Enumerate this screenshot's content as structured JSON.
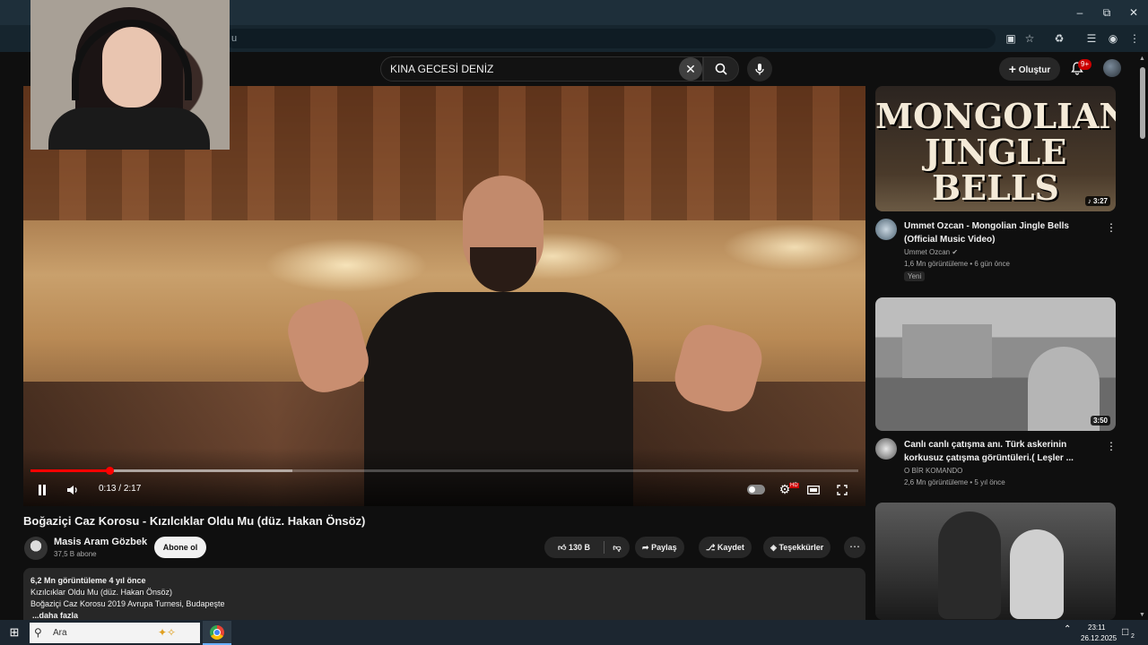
{
  "browser": {
    "address_fragment": "u",
    "window_controls": [
      "minimize-icon",
      "restore-icon",
      "close-icon"
    ],
    "toolbar_icons": [
      "cast-icon",
      "bookmark-star-icon",
      "extensions-icon",
      "media-control-icon",
      "profile-icon",
      "menu-kebab-icon"
    ]
  },
  "masthead": {
    "search_query": "KINA GECESİ DENİZ",
    "create_label": "Oluştur",
    "notifications_badge": "9+"
  },
  "player": {
    "current_time": "0:13",
    "separator": "/",
    "duration": "2:17",
    "progress_fraction": 0.095,
    "buffered_fraction": 0.316
  },
  "video": {
    "title": "Boğaziçi Caz Korosu - Kızılcıklar Oldu Mu (düz. Hakan Önsöz)",
    "channel": "Masis Aram Gözbek",
    "subscribers": "37,5 B abone",
    "subscribe_label": "Abone ol",
    "likes": "130 B",
    "share_label": "Paylaş",
    "save_label": "Kaydet",
    "thanks_label": "Teşekkürler",
    "description": {
      "stats": "6,2 Mn görüntüleme  4 yıl önce",
      "line1": "Kızılcıklar Oldu Mu (düz. Hakan Önsöz)",
      "line2": "Boğaziçi Caz Korosu 2019 Avrupa Turnesi, Budapeşte",
      "more": "...daha fazla"
    }
  },
  "sidebar": {
    "items": [
      {
        "thumb_text": "MONGOLIAN JINGLE BELLS",
        "duration": "3:27",
        "title": "Ummet Ozcan - Mongolian Jingle Bells (Official Music Video)",
        "channel": "Ummet Ozcan",
        "meta": "1,6 Mn görüntüleme • 6 gün önce",
        "badge": "Yeni"
      },
      {
        "duration": "3:50",
        "title": "Canlı canlı çatışma anı. Türk askerinin korkusuz çatışma görüntüleri.( Leşler ...",
        "channel": "O BİR KOMANDO",
        "meta": "2,6 Mn görüntüleme • 5 yıl önce"
      },
      {}
    ]
  },
  "taskbar": {
    "search_placeholder": "Ara",
    "time": "23:11",
    "date": "26.12.2025",
    "notification_count": "2"
  }
}
